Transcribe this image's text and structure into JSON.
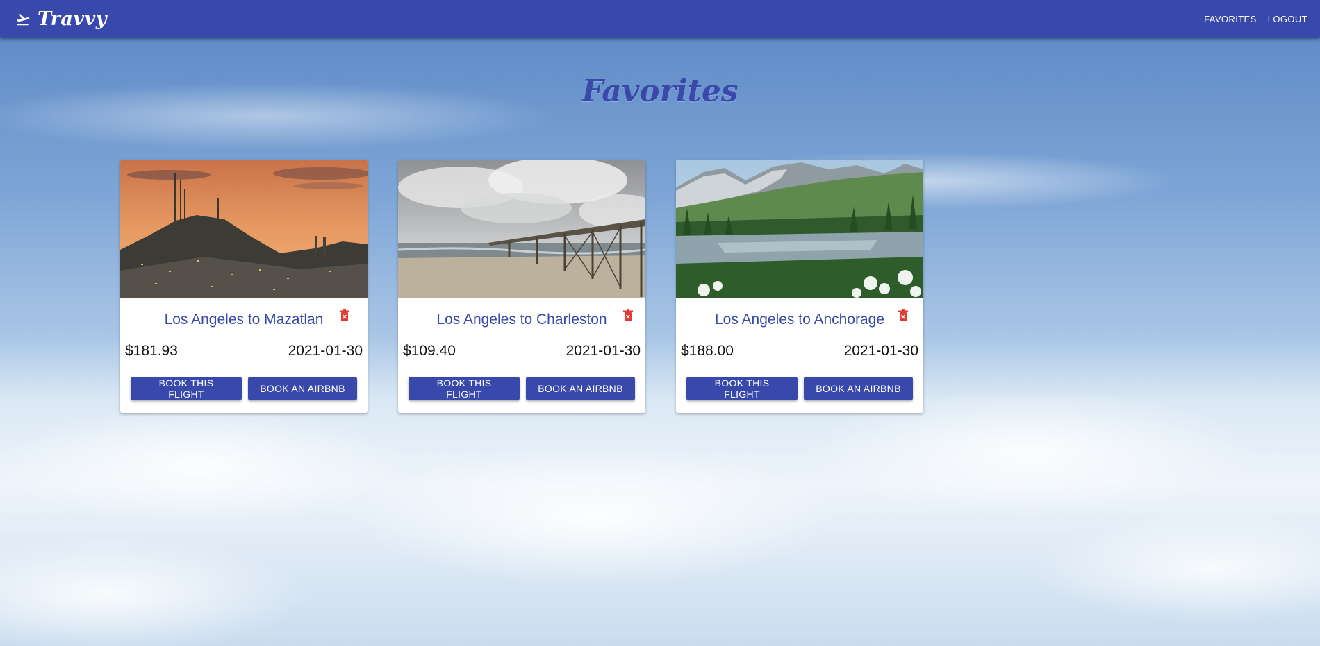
{
  "header": {
    "brand": "Travvy",
    "brand_icon": "airplane-takeoff-icon",
    "nav": [
      {
        "label": "FAVORITES"
      },
      {
        "label": "LOGOUT"
      }
    ]
  },
  "page": {
    "title": "Favorites"
  },
  "colors": {
    "primary": "#3949ab",
    "delete": "#e53935"
  },
  "favorites": [
    {
      "title": "Los Angeles to Mazatlan",
      "price": "$181.93",
      "date": "2021-01-30",
      "image": "mazatlan-sunset-city-photo",
      "book_flight_label": "BOOK THIS FLIGHT",
      "book_airbnb_label": "BOOK AN AIRBNB"
    },
    {
      "title": "Los Angeles to Charleston",
      "price": "$109.40",
      "date": "2021-01-30",
      "image": "charleston-pier-beach-photo",
      "book_flight_label": "BOOK THIS FLIGHT",
      "book_airbnb_label": "BOOK AN AIRBNB"
    },
    {
      "title": "Los Angeles to Anchorage",
      "price": "$188.00",
      "date": "2021-01-30",
      "image": "anchorage-mountain-lake-photo",
      "book_flight_label": "BOOK THIS FLIGHT",
      "book_airbnb_label": "BOOK AN AIRBNB"
    }
  ]
}
